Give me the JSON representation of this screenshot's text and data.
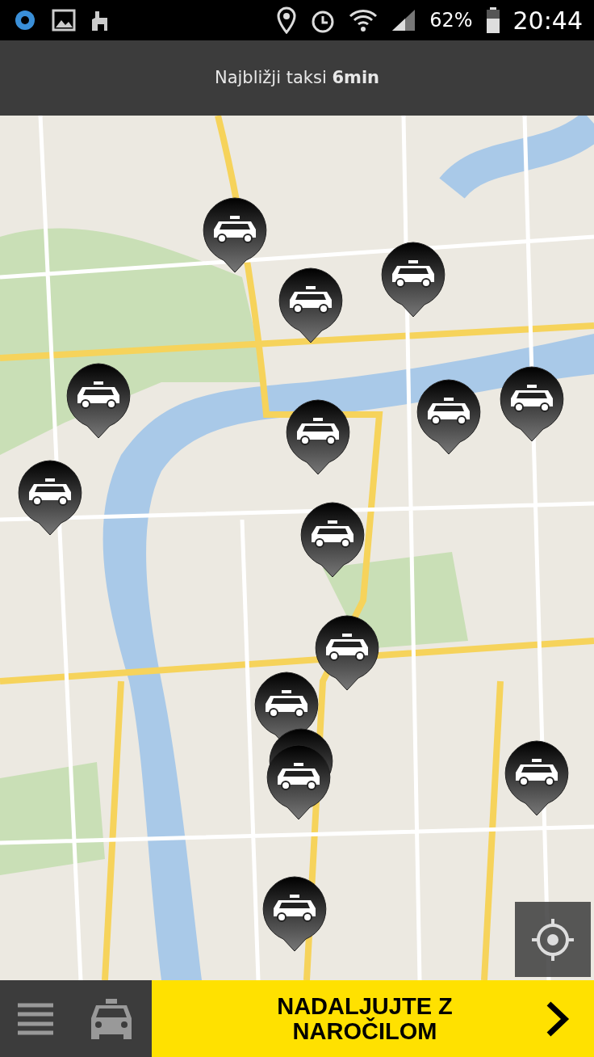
{
  "status_bar": {
    "battery": "62%",
    "time": "20:44"
  },
  "header": {
    "text": "Najbližji taksi **6min**"
  },
  "bottom_bar": {
    "action_button": {
      "label": "NADALJUJTE Z NAROČILOM"
    }
  }
}
